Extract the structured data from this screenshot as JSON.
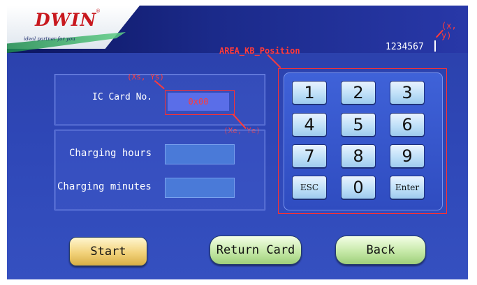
{
  "header": {
    "logo": {
      "word": "DWIN",
      "registered": "®",
      "tagline": "ideal partner for you"
    },
    "display_value": "1234567"
  },
  "annotations": {
    "xy": "(x, y)",
    "area": "AREA_KB_Position",
    "start_point": "(Xs, Ys)",
    "end_point": "(Xe, Ye)"
  },
  "ic_card": {
    "label": "IC Card No.",
    "value": "0x00"
  },
  "charging": {
    "hours_label": "Charging hours",
    "hours_value": "",
    "minutes_label": "Charging minutes",
    "minutes_value": ""
  },
  "keypad": {
    "keys": [
      "1",
      "2",
      "3",
      "4",
      "5",
      "6",
      "7",
      "8",
      "9",
      "ESC",
      "0",
      "Enter"
    ]
  },
  "buttons": {
    "start": "Start",
    "return_card": "Return Card",
    "back": "Back"
  },
  "colors": {
    "annotation": "#ff3b3b",
    "background": "#2f48b8",
    "key_face": "#bfe0f8"
  }
}
